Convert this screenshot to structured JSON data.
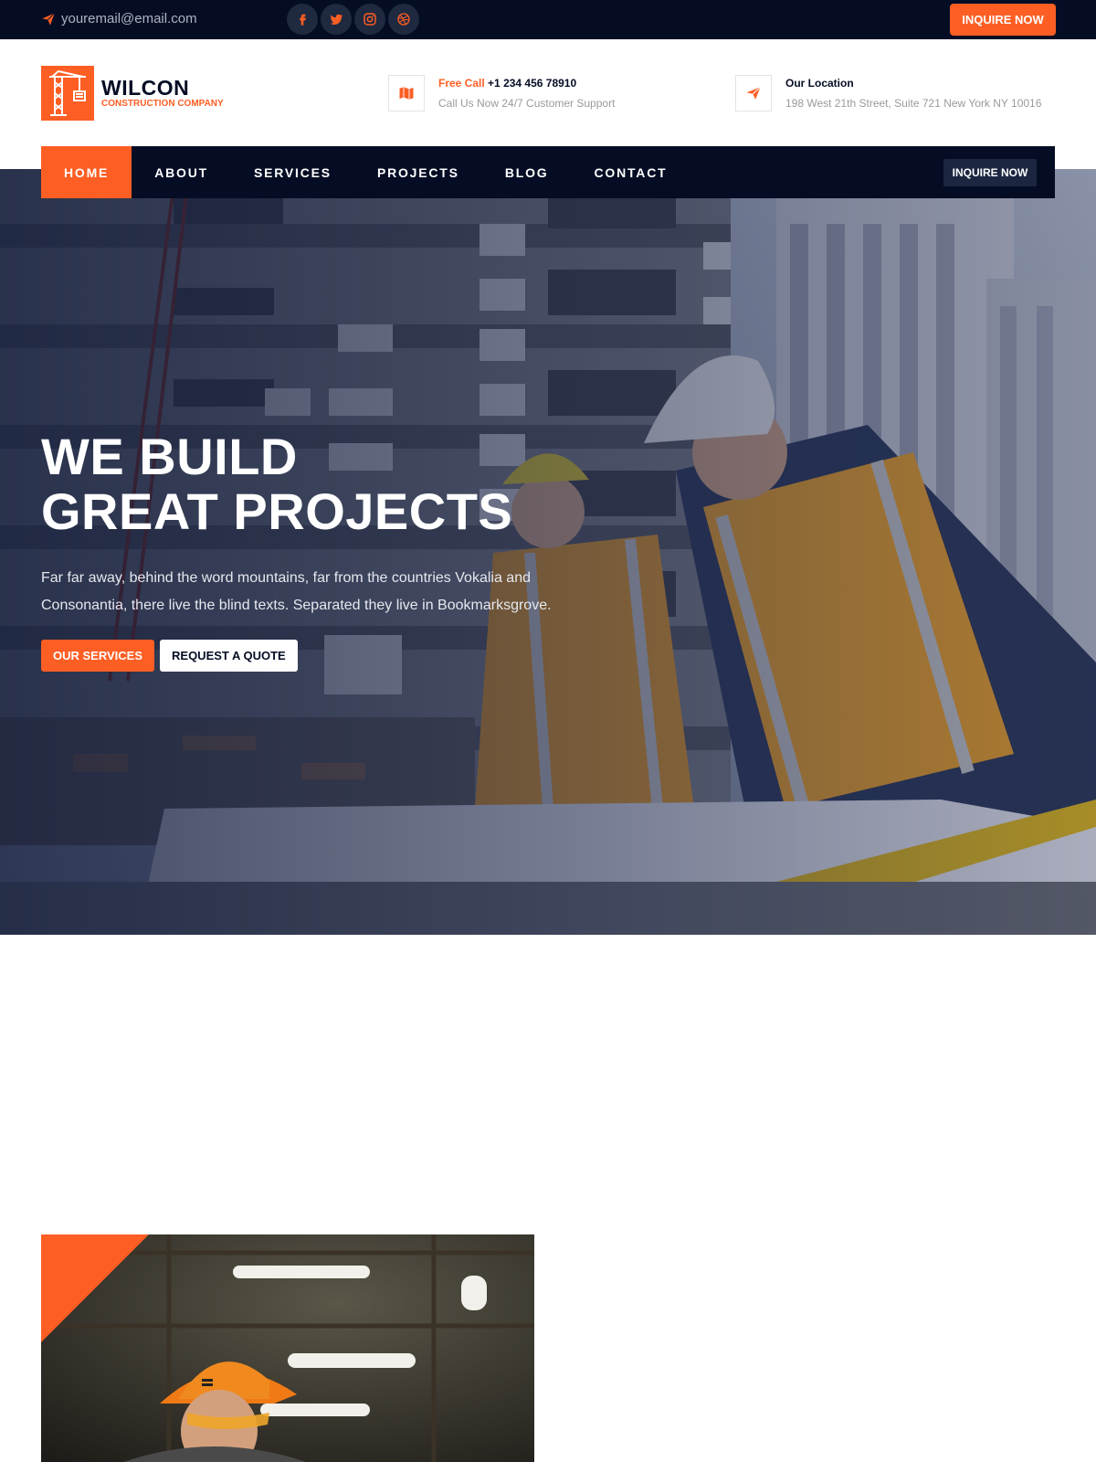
{
  "topbar": {
    "email": "youremail@email.com",
    "socials": [
      "facebook-icon",
      "twitter-icon",
      "instagram-icon",
      "dribbble-icon"
    ],
    "inquire_label": "INQUIRE NOW"
  },
  "brand": {
    "name": "WILCON",
    "tagline": "CONSTRUCTION COMPANY",
    "icon": "crane-icon"
  },
  "contact": {
    "call_label": "Free Call",
    "phone": "+1 234 456 78910",
    "call_sub": "Call Us Now 24/7 Customer Support",
    "location_label": "Our Location",
    "address": "198 West 21th Street, Suite 721 New York NY 10016"
  },
  "nav": {
    "items": [
      "HOME",
      "ABOUT",
      "SERVICES",
      "PROJECTS",
      "BLOG",
      "CONTACT"
    ],
    "active": "HOME",
    "inquire_label": "INQUIRE NOW"
  },
  "hero": {
    "title_line1": "WE BUILD",
    "title_line2": "GREAT PROJECTS",
    "text": "Far far away, behind the word mountains, far from the countries Vokalia and Consonantia, there live the blind texts. Separated they live in Bookmarksgrove.",
    "primary_button": "OUR SERVICES",
    "secondary_button": "REQUEST A QUOTE"
  },
  "colors": {
    "accent": "#fd5e24",
    "dark": "#050d24"
  }
}
